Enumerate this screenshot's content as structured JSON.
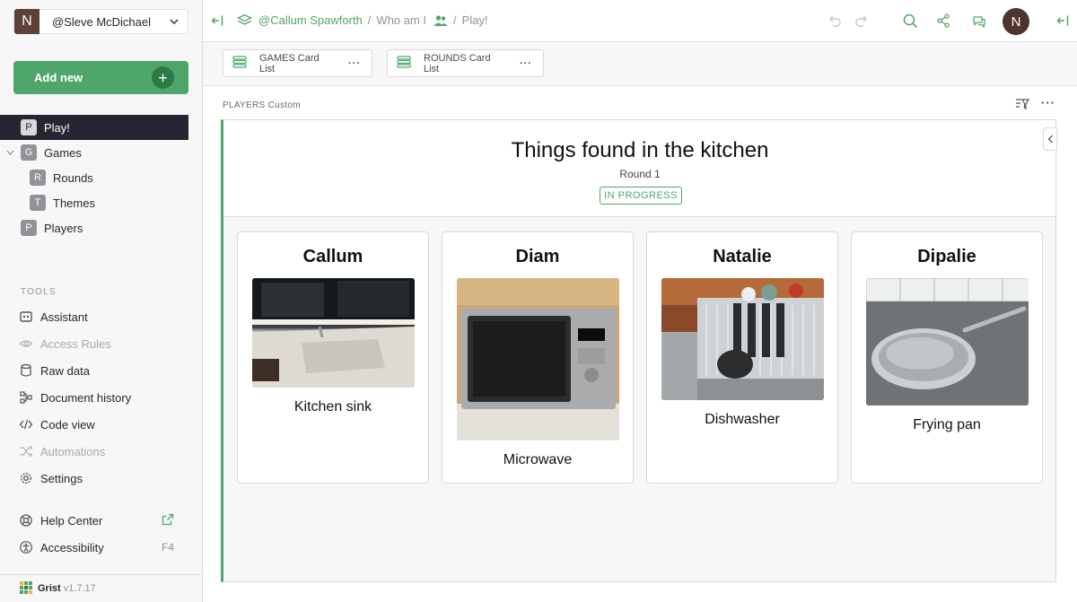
{
  "org": {
    "badge": "N",
    "name": "@Sleve McDichael"
  },
  "sidebar": {
    "add_new": "Add new",
    "pages": [
      {
        "badge": "P",
        "label": "Play!"
      },
      {
        "badge": "G",
        "label": "Games"
      },
      {
        "badge": "R",
        "label": "Rounds"
      },
      {
        "badge": "T",
        "label": "Themes"
      },
      {
        "badge": "P",
        "label": "Players"
      }
    ],
    "tools_heading": "TOOLS",
    "tools": [
      {
        "label": "Assistant",
        "icon": "assistant-icon"
      },
      {
        "label": "Access Rules",
        "icon": "eye-icon"
      },
      {
        "label": "Raw data",
        "icon": "database-icon"
      },
      {
        "label": "Document history",
        "icon": "history-icon"
      },
      {
        "label": "Code view",
        "icon": "code-icon"
      },
      {
        "label": "Automations",
        "icon": "shuffle-icon"
      },
      {
        "label": "Settings",
        "icon": "gear-icon"
      }
    ],
    "help_center": "Help Center",
    "accessibility": "Accessibility",
    "accessibility_key": "F4",
    "footer": {
      "name": "Grist",
      "version": "v1.7.17"
    }
  },
  "breadcrumb": {
    "workspace": "@Callum Spawforth",
    "sep1": "/",
    "document": "Who am I",
    "sep2": "/",
    "page": "Play!"
  },
  "user_avatar": "N",
  "widgets": {
    "games_tab": "GAMES Card List",
    "rounds_tab": "ROUNDS Card List",
    "players_section": "PLAYERS Custom"
  },
  "game": {
    "title": "Things found in the kitchen",
    "round": "Round 1",
    "status": "IN PROGRESS"
  },
  "players": [
    {
      "name": "Callum",
      "answer": "Kitchen sink"
    },
    {
      "name": "Diam",
      "answer": "Microwave"
    },
    {
      "name": "Natalie",
      "answer": "Dishwasher"
    },
    {
      "name": "Dipalie",
      "answer": "Frying pan"
    }
  ],
  "colors": {
    "accent": "#4fa66a",
    "dark": "#262633",
    "org_badge": "#5d4037"
  }
}
